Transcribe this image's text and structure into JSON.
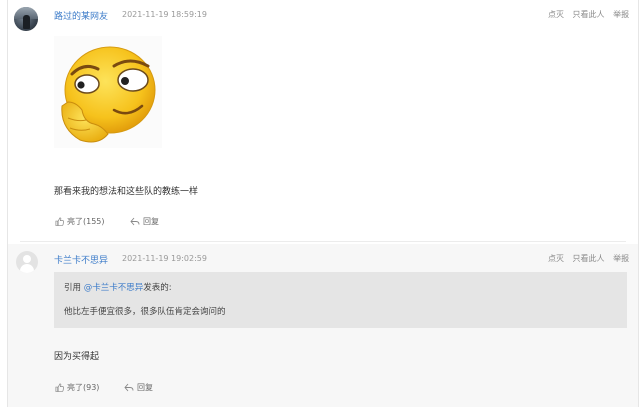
{
  "comments": [
    {
      "username": "路过的某网友",
      "timestamp": "2021-11-19 18:59:19",
      "actions": [
        "点灭",
        "只看此人",
        "举报"
      ],
      "text": "那看来我的想法和这些队的教练一样",
      "like_label": "亮了(155)",
      "reply_label": "回复"
    },
    {
      "username": "卡兰卡不思异",
      "timestamp": "2021-11-19 19:02:59",
      "actions": [
        "点灭",
        "只看此人",
        "举报"
      ],
      "quote": {
        "prefix": "引用 ",
        "user": "@卡兰卡不思异",
        "suffix": "发表的:",
        "text": "他比左手便宜很多，很多队伍肯定会询问的"
      },
      "text": "因为买得起",
      "like_label": "亮了(93)",
      "reply_label": "回复"
    }
  ],
  "icons": {
    "like": "thumbs-up-icon",
    "reply": "reply-arrow-icon",
    "meme": "emoji-meme-image"
  },
  "colors": {
    "link": "#3d7cc9",
    "muted": "#999999",
    "quote_bg": "#e5e5e5"
  }
}
